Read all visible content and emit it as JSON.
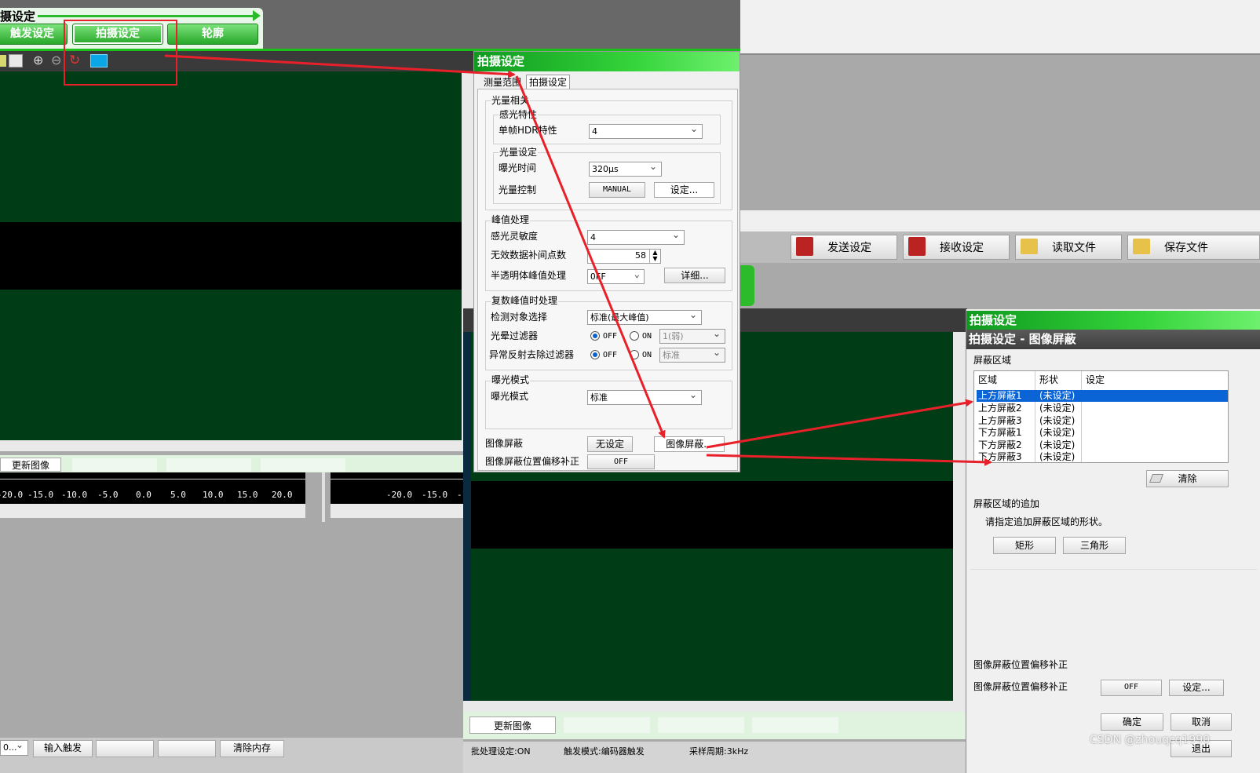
{
  "main_window": {
    "top_title": "摄设定",
    "tabs": [
      "触发设定",
      "拍摄设定",
      "轮廓"
    ],
    "update_image": "更新图像",
    "axis_ticks_left": [
      "-20.0",
      "-15.0",
      "-10.0",
      "-5.0",
      "0.0",
      "5.0",
      "10.0",
      "15.0",
      "20.0"
    ],
    "axis_ticks_right": [
      "-20.0",
      "-15.0",
      "-1"
    ],
    "bottom_buttons": {
      "combo": "0...",
      "input_trigger": "输入触发",
      "clear_memory": "清除内存"
    }
  },
  "toolbar_right": {
    "send": "发送设定",
    "receive": "接收设定",
    "read_file": "读取文件",
    "save_file": "保存文件"
  },
  "capture_panel": {
    "title": "拍摄设定",
    "tabs": [
      "测量范围",
      "拍摄设定"
    ],
    "light_group": "光量相关",
    "sensitivity_group": "感光特性",
    "hdr_label": "单帧HDR特性",
    "hdr_value": "4",
    "light_setting_group": "光量设定",
    "exposure_label": "曝光时间",
    "exposure_value": "320μs",
    "light_control_label": "光量控制",
    "light_control_mode": "MANUAL",
    "light_control_set": "设定...",
    "peak_group": "峰值处理",
    "sensitivity_label": "感光灵敏度",
    "sensitivity_value": "4",
    "interp_label": "无效数据补间点数",
    "interp_value": "58",
    "translucent_label": "半透明体峰值处理",
    "translucent_value": "OFF",
    "detail_button": "详细...",
    "multi_peak_group": "复数峰值时处理",
    "detect_label": "检测对象选择",
    "detect_value": "标准(最大峰值)",
    "halo_label": "光晕过滤器",
    "halo_off": "OFF",
    "halo_on": "ON",
    "halo_level": "1(弱)",
    "reflect_label": "异常反射去除过滤器",
    "reflect_off": "OFF",
    "reflect_on": "ON",
    "reflect_level": "标准",
    "expo_mode_group": "曝光模式",
    "expo_mode_label": "曝光模式",
    "expo_mode_value": "标准",
    "mask_label": "图像屏蔽",
    "mask_value": "无设定",
    "mask_button": "图像屏蔽...",
    "mask_offset_label": "图像屏蔽位置偏移补正",
    "mask_offset_value": "OFF"
  },
  "second_window": {
    "update_image": "更新图像",
    "status": {
      "batch": "批处理设定:ON",
      "trigger": "触发模式:编码器触发",
      "sampling": "采样周期:3kHz"
    }
  },
  "mask_panel": {
    "title": "拍摄设定",
    "subtitle": "拍摄设定 - 图像屏蔽",
    "area_group": "屏蔽区域",
    "columns": [
      "区域",
      "形状",
      "设定"
    ],
    "rows": [
      {
        "area": "上方屏蔽1",
        "shape": "(未设定)",
        "setting": ""
      },
      {
        "area": "上方屏蔽2",
        "shape": "(未设定)",
        "setting": ""
      },
      {
        "area": "上方屏蔽3",
        "shape": "(未设定)",
        "setting": ""
      },
      {
        "area": "下方屏蔽1",
        "shape": "(未设定)",
        "setting": ""
      },
      {
        "area": "下方屏蔽2",
        "shape": "(未设定)",
        "setting": ""
      },
      {
        "area": "下方屏蔽3",
        "shape": "(未设定)",
        "setting": ""
      }
    ],
    "clear_button": "清除",
    "add_group": "屏蔽区域的追加",
    "add_hint": "请指定追加屏蔽区域的形状。",
    "rect_button": "矩形",
    "triangle_button": "三角形",
    "offset_group": "图像屏蔽位置偏移补正",
    "offset_label": "图像屏蔽位置偏移补正",
    "offset_value": "OFF",
    "offset_set": "设定...",
    "ok": "确定",
    "cancel": "取消",
    "exit": "退出"
  },
  "watermark": "CSDN @zhouqcq1990",
  "colors": {
    "accent_green": "#22c12e",
    "plot_green": "#003c16",
    "arrow_red": "#e8202a",
    "selection_blue": "#0a64d6"
  }
}
